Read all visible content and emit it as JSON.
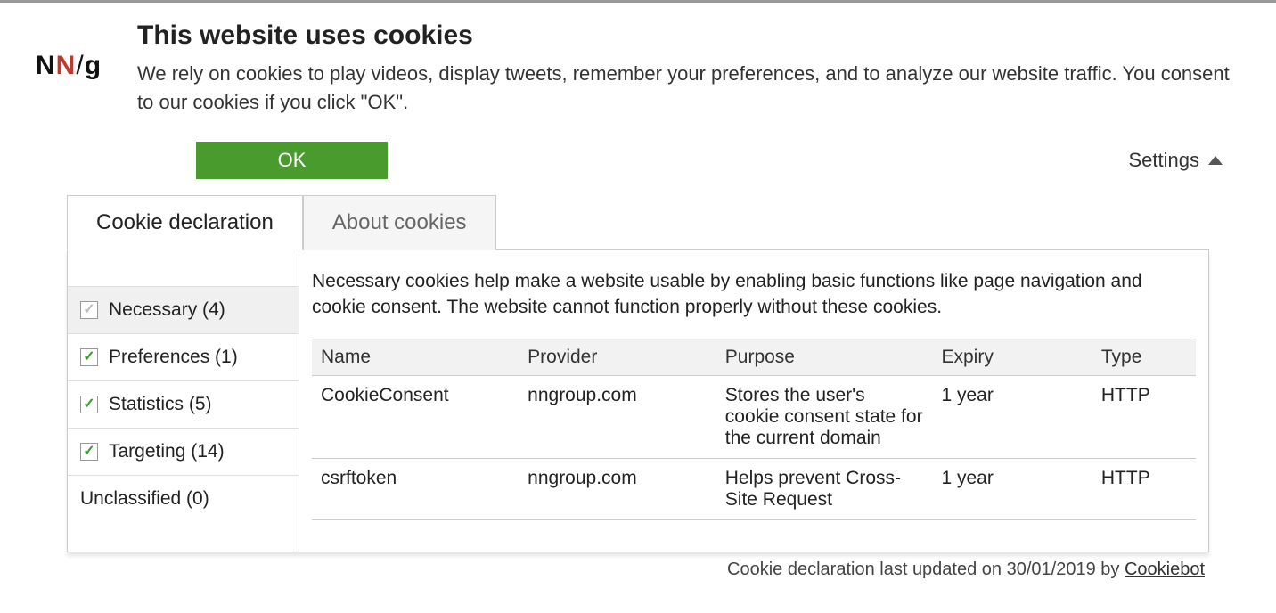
{
  "logo": {
    "n1": "N",
    "n2": "N",
    "slash": "/",
    "g": "g"
  },
  "header": {
    "title": "This website uses cookies",
    "description": "We rely on cookies to play videos, display tweets, remember your preferences, and to analyze our website traffic. You consent to our cookies if you click \"OK\"."
  },
  "actions": {
    "ok_label": "OK",
    "settings_label": "Settings"
  },
  "tabs": [
    {
      "label": "Cookie declaration",
      "active": true
    },
    {
      "label": "About cookies",
      "active": false
    }
  ],
  "categories": [
    {
      "label": "Necessary (4)",
      "checked": true,
      "disabled": true
    },
    {
      "label": "Preferences (1)",
      "checked": true,
      "disabled": false
    },
    {
      "label": "Statistics (5)",
      "checked": true,
      "disabled": false
    },
    {
      "label": "Targeting (14)",
      "checked": true,
      "disabled": false
    },
    {
      "label": "Unclassified (0)",
      "checked": false,
      "disabled": false,
      "nocheck": true
    }
  ],
  "category_description": "Necessary cookies help make a website usable by enabling basic functions like page navigation and cookie consent. The website cannot function properly without these cookies.",
  "table": {
    "headers": [
      "Name",
      "Provider",
      "Purpose",
      "Expiry",
      "Type"
    ],
    "rows": [
      {
        "name": "CookieConsent",
        "provider": "nngroup.com",
        "purpose": "Stores the user's cookie consent state for the current domain",
        "expiry": "1 year",
        "type": "HTTP"
      },
      {
        "name": "csrftoken",
        "provider": "nngroup.com",
        "purpose": "Helps prevent Cross-Site Request",
        "expiry": "1 year",
        "type": "HTTP"
      }
    ]
  },
  "footer": {
    "prefix": "Cookie declaration last updated on 30/01/2019 by ",
    "link": "Cookiebot"
  }
}
